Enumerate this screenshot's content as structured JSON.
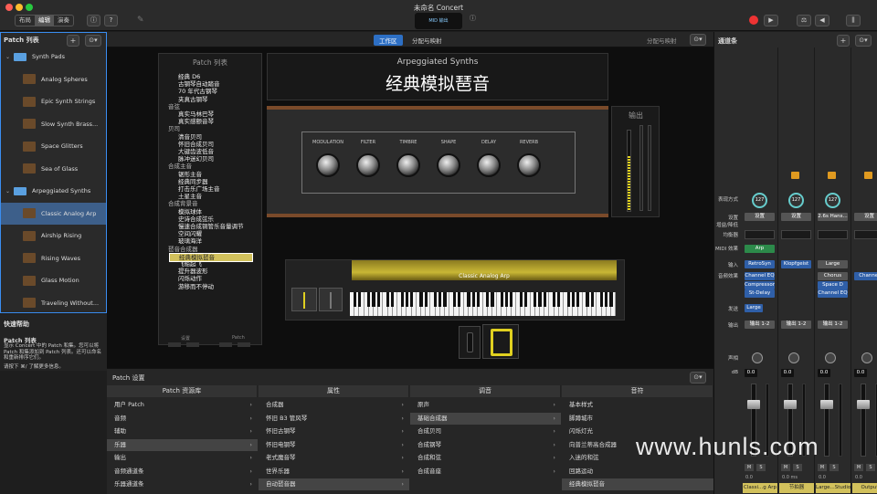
{
  "window": {
    "title": "未命名 Concert"
  },
  "toolbar": {
    "modes": [
      "布局",
      "编辑",
      "演奏"
    ],
    "active_mode": "编辑",
    "lcd": "MID 输出"
  },
  "left": {
    "title": "Patch 列表",
    "items": [
      {
        "label": "Synth Pads",
        "kind": "folder"
      },
      {
        "label": "Analog Spheres",
        "kind": "patch"
      },
      {
        "label": "Epic Synth Strings",
        "kind": "patch"
      },
      {
        "label": "Slow Synth Brass...",
        "kind": "patch"
      },
      {
        "label": "Space Glitters",
        "kind": "patch"
      },
      {
        "label": "Sea of Glass",
        "kind": "patch"
      },
      {
        "label": "Arpeggiated Synths",
        "kind": "folder"
      },
      {
        "label": "Classic Analog Arp",
        "kind": "patch",
        "selected": true
      },
      {
        "label": "Airship Rising",
        "kind": "patch"
      },
      {
        "label": "Rising Waves",
        "kind": "patch"
      },
      {
        "label": "Glass Motion",
        "kind": "patch"
      },
      {
        "label": "Traveling Without...",
        "kind": "patch"
      }
    ],
    "help_title": "快速帮助",
    "help_heading": "Patch 列表",
    "help_text": "显示 Concert 中的 Patch 和集。您可以将 Patch 和集添加到 Patch 列表。还可以命名和重新排序它们。",
    "help_more": "请按下 ⌘/ 了解更多信息。"
  },
  "center": {
    "tab_workspace": "工作区",
    "tab_assign": "分配与映射",
    "assign_right": "分配与映射",
    "patchlist_title": "Patch 列表",
    "patchlist": [
      {
        "t": "经典 D6",
        "k": "item"
      },
      {
        "t": "古钢琴自动踏音",
        "k": "item"
      },
      {
        "t": "70 年代古钢琴",
        "k": "item"
      },
      {
        "t": "夹真古钢琴",
        "k": "item"
      },
      {
        "t": "音弦",
        "k": "cat"
      },
      {
        "t": "真实马林巴琴",
        "k": "item"
      },
      {
        "t": "真实感颤音琴",
        "k": "item"
      },
      {
        "t": "贝司",
        "k": "cat"
      },
      {
        "t": "清音贝司",
        "k": "item"
      },
      {
        "t": "怀旧合成贝司",
        "k": "item"
      },
      {
        "t": "大键齿波低音",
        "k": "item"
      },
      {
        "t": "脉冲迷幻贝司",
        "k": "item"
      },
      {
        "t": "合成主音",
        "k": "cat"
      },
      {
        "t": "锯形主音",
        "k": "item"
      },
      {
        "t": "经典同步器",
        "k": "item"
      },
      {
        "t": "打击乐广场主音",
        "k": "item"
      },
      {
        "t": "土星主音",
        "k": "item"
      },
      {
        "t": "合成背景音",
        "k": "cat"
      },
      {
        "t": "模拟球体",
        "k": "item"
      },
      {
        "t": "史诗合成弦乐",
        "k": "item"
      },
      {
        "t": "慢速合成铜管乐音量调节",
        "k": "item"
      },
      {
        "t": "空间闪耀",
        "k": "item"
      },
      {
        "t": "玻璃海洋",
        "k": "item"
      },
      {
        "t": "琶音合成器",
        "k": "cat"
      },
      {
        "t": "经典模拟琶音",
        "k": "sel"
      },
      {
        "t": "飞船起飞",
        "k": "item"
      },
      {
        "t": "提升器波形",
        "k": "item"
      },
      {
        "t": "闪烁动作",
        "k": "item"
      },
      {
        "t": "游移而不停动",
        "k": "item"
      }
    ],
    "setting_label": "设置",
    "patch_label": "Patch",
    "synth_subtitle": "Arpeggiated Synths",
    "synth_title": "经典模拟琶音",
    "output_label": "输出",
    "knobs": [
      "MODULATION",
      "FILTER",
      "TIMBRE",
      "SHAPE",
      "DELAY",
      "REVERB"
    ],
    "keyboard_label": "Classic Analog Arp"
  },
  "bottom": {
    "title": "Patch 设置",
    "col_library": "Patch 资源库",
    "col_attr": "属性",
    "col_tone": "调音",
    "col_note": "音符",
    "library": [
      {
        "t": "用户 Patch",
        "a": true
      },
      {
        "t": "音频",
        "a": true
      },
      {
        "t": "辅助",
        "a": true
      },
      {
        "t": "乐器",
        "a": true,
        "sel": true
      },
      {
        "t": "输出",
        "a": true
      },
      {
        "t": "音频通道条",
        "a": true
      },
      {
        "t": "乐器通道条",
        "a": true
      }
    ],
    "attr": [
      {
        "t": "合成器",
        "a": true
      },
      {
        "t": "怀旧 B3 管风琴",
        "a": true
      },
      {
        "t": "怀旧古钢琴",
        "a": true
      },
      {
        "t": "怀旧电钢琴",
        "a": true
      },
      {
        "t": "老式魔音琴",
        "a": true
      },
      {
        "t": "世界乐器",
        "a": true
      },
      {
        "t": "自动琶音器",
        "a": true,
        "sel": true
      }
    ],
    "tone": [
      {
        "t": "原声",
        "a": true
      },
      {
        "t": "基础合成器",
        "a": true,
        "sel": true
      },
      {
        "t": "合成贝司",
        "a": true
      },
      {
        "t": "合成钢琴",
        "a": true
      },
      {
        "t": "合成和弦",
        "a": true
      },
      {
        "t": "合成音座",
        "a": true
      }
    ],
    "note": [
      {
        "t": "基本样式"
      },
      {
        "t": "脚蹲城市"
      },
      {
        "t": "闪烁灯光"
      },
      {
        "t": "向普兰蒂高合成器"
      },
      {
        "t": "入迷的和弦"
      },
      {
        "t": "回路运动"
      },
      {
        "t": "经典模拟琶音",
        "sel": true
      }
    ]
  },
  "mixer": {
    "title": "通道条",
    "row_labels": [
      "表现方式",
      "设置",
      "增益/降低",
      "均衡器",
      "MIDI 效果",
      "输入",
      "音频效果",
      "发送",
      "输出",
      "声相",
      "dB"
    ],
    "strips": [
      {
        "dial": "127",
        "setting": "设置",
        "midi": "Arp",
        "input": "RetroSyn",
        "fx": [
          "Channel EQ",
          "Compressor",
          "St-Delay"
        ],
        "mode": "Large",
        "output": "输出 1-2",
        "db": "0.0",
        "vol": "0.0",
        "name": "Classi...g Arp",
        "color": "#d2c15c"
      },
      {
        "dial": "127",
        "setting": "设置",
        "midi": "",
        "input": "Klopfgeist",
        "fx": [],
        "mode": "",
        "output": "输出 1-2",
        "db": "0.0",
        "vol": "0.0 ms",
        "name": "节拍器",
        "color": "#d2c15c"
      },
      {
        "dial": "127",
        "setting": "2.6s Hans...",
        "midi": "",
        "input": "Large",
        "fx": [
          "Chorus",
          "Space D",
          "Channel EQ"
        ],
        "mode": "",
        "output": "输出 1-2",
        "db": "0.0",
        "vol": "0.0",
        "name": "Large...Studio",
        "color": "#d2c15c"
      },
      {
        "dial": "",
        "setting": "设置",
        "midi": "",
        "input": "",
        "fx": [
          "Channel"
        ],
        "mode": "",
        "output": "",
        "db": "0.0",
        "vol": "0.0",
        "name": "Output",
        "color": "#d2c15c"
      }
    ],
    "m": "M",
    "s": "S"
  },
  "watermark": "www.hunls.com"
}
